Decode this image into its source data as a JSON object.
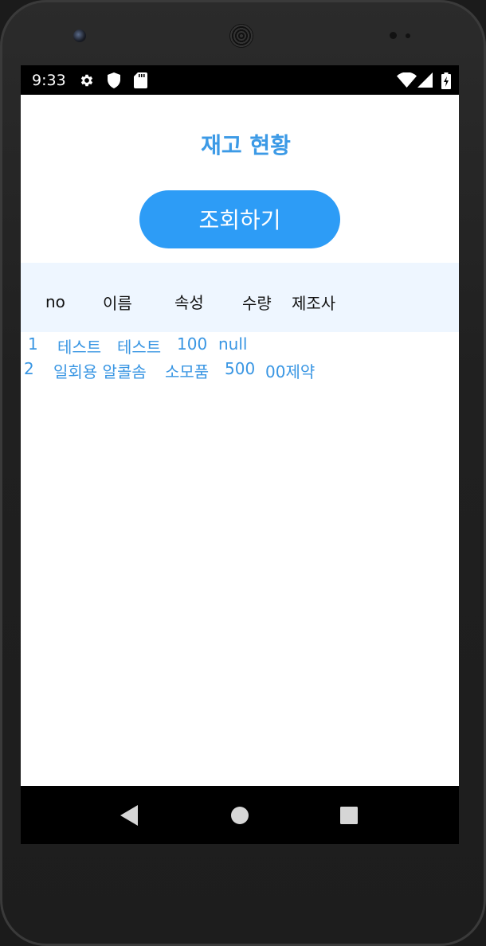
{
  "status_bar": {
    "time": "9:33",
    "left_icons": [
      "gear-icon",
      "shield-icon",
      "sd-card-icon"
    ],
    "right_icons": [
      "wifi-icon",
      "signal-icon",
      "battery-charging-icon"
    ]
  },
  "screen": {
    "title": "재고 현황",
    "query_button_label": "조회하기",
    "table": {
      "headers": [
        "no",
        "이름",
        "속성",
        "수량",
        "제조사"
      ],
      "rows": [
        [
          "1",
          "테스트",
          "테스트",
          "100",
          "null"
        ],
        [
          "2",
          "일회용 알콜솜",
          "소모품",
          "500",
          "00제약"
        ]
      ]
    }
  },
  "nav_bar": {
    "buttons": [
      "back-icon",
      "home-icon",
      "recents-icon"
    ]
  },
  "colors": {
    "accent": "#2d9cf6",
    "title": "#3c9ae6",
    "row_text": "#3996e3",
    "header_bg": "#eef6ff"
  }
}
